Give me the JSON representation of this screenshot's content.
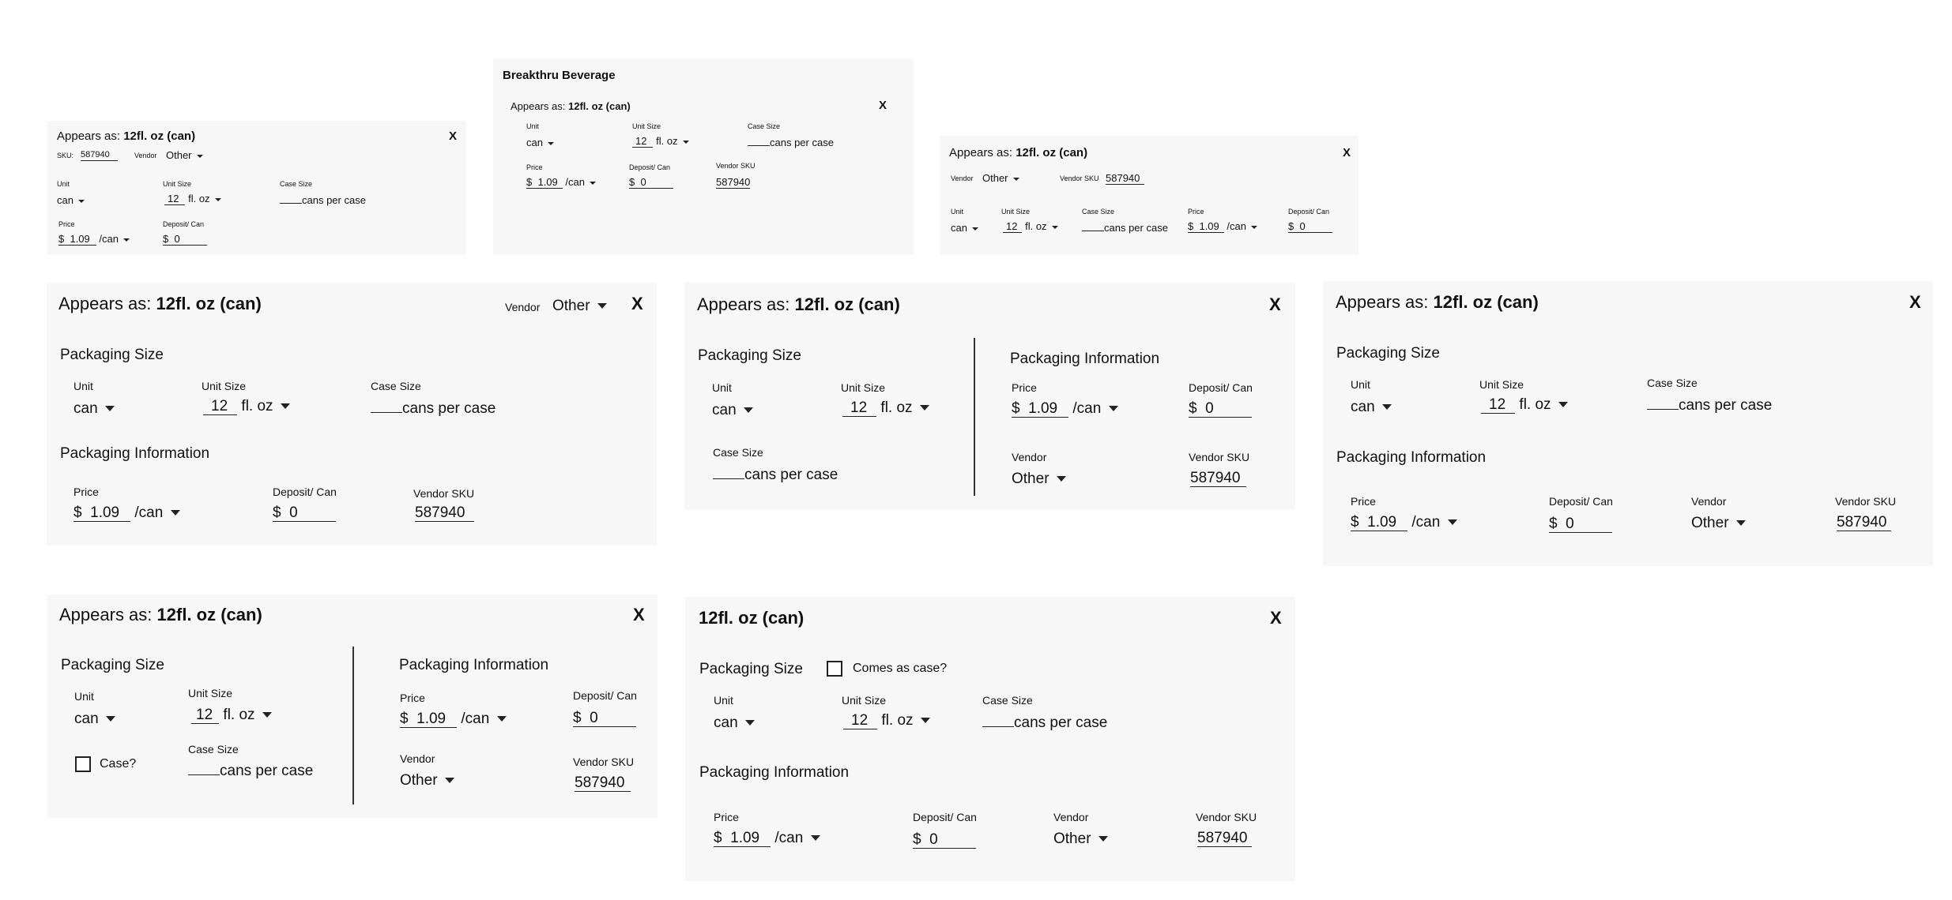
{
  "common": {
    "appears_as_label": "Appears as:",
    "product_label": "12fl. oz (can)",
    "close_label": "X",
    "packaging_size_title": "Packaging Size",
    "packaging_info_title": "Packaging Information",
    "unit_label": "Unit",
    "unit_value": "can",
    "unit_size_label": "Unit Size",
    "unit_size_value": "12",
    "unit_size_suffix": "fl. oz",
    "case_size_label": "Case Size",
    "case_size_suffix": "cans per case",
    "price_label": "Price",
    "currency_symbol": "$",
    "price_value": "1.09",
    "price_per": "/can",
    "deposit_label": "Deposit/ Can",
    "deposit_value": "0",
    "vendor_label": "Vendor",
    "vendor_value": "Other",
    "vendor_sku_label": "Vendor SKU",
    "sku_value": "587940",
    "sku_label": "SKU:"
  },
  "mini_card_2": {
    "vendor_name": "Breakthru Beverage"
  },
  "card_8": {
    "case_checkbox_label": "Case?"
  },
  "card_9": {
    "comes_as_case_label": "Comes as case?"
  }
}
